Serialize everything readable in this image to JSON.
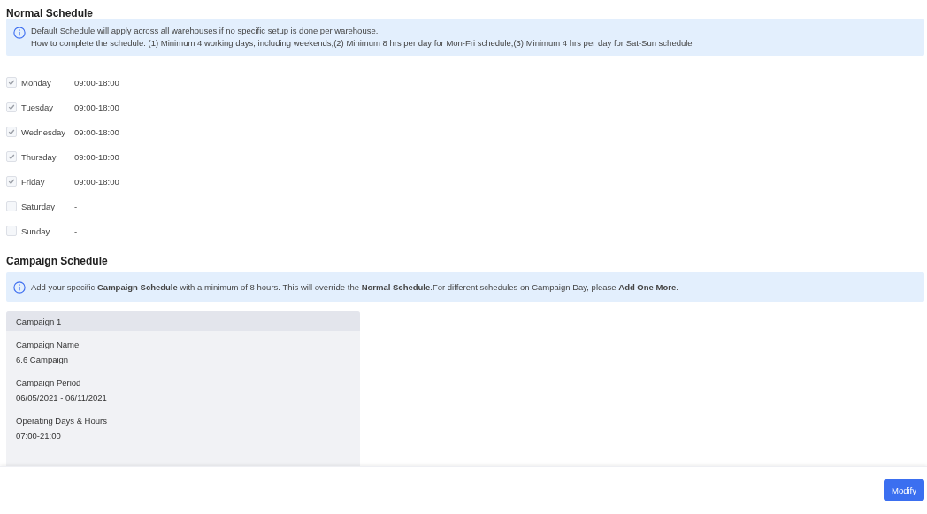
{
  "normal_schedule": {
    "title": "Normal Schedule",
    "notice": [
      "Default Schedule will apply across all warehouses if no specific setup is done per warehouse.",
      "How to complete the schedule: (1) Minimum 4 working days, including weekends;(2) Minimum 8 hrs per day for Mon-Fri schedule;(3) Minimum 4 hrs per day for Sat-Sun schedule"
    ],
    "days": [
      {
        "day": "Monday",
        "hours": "09:00-18:00",
        "checked": true
      },
      {
        "day": "Tuesday",
        "hours": "09:00-18:00",
        "checked": true
      },
      {
        "day": "Wednesday",
        "hours": "09:00-18:00",
        "checked": true
      },
      {
        "day": "Thursday",
        "hours": "09:00-18:00",
        "checked": true
      },
      {
        "day": "Friday",
        "hours": "09:00-18:00",
        "checked": true
      },
      {
        "day": "Saturday",
        "hours": "-",
        "checked": false
      },
      {
        "day": "Sunday",
        "hours": "-",
        "checked": false
      }
    ]
  },
  "campaign_schedule": {
    "title": "Campaign Schedule",
    "notice": "Add your specific **Campaign Schedule** with a minimum of 8 hours. This will override the **Normal Schedule**.For different schedules on Campaign Day, please **Add One More**.",
    "campaigns": [
      {
        "header": "Campaign 1",
        "fields": [
          {
            "label": "Campaign Name",
            "value": "6.6 Campaign"
          },
          {
            "label": "Campaign Period",
            "value": "06/05/2021 - 06/11/2021"
          },
          {
            "label": "Operating Days & Hours",
            "value": "07:00-21:00"
          }
        ]
      }
    ]
  },
  "footer": {
    "button": "Modify"
  }
}
